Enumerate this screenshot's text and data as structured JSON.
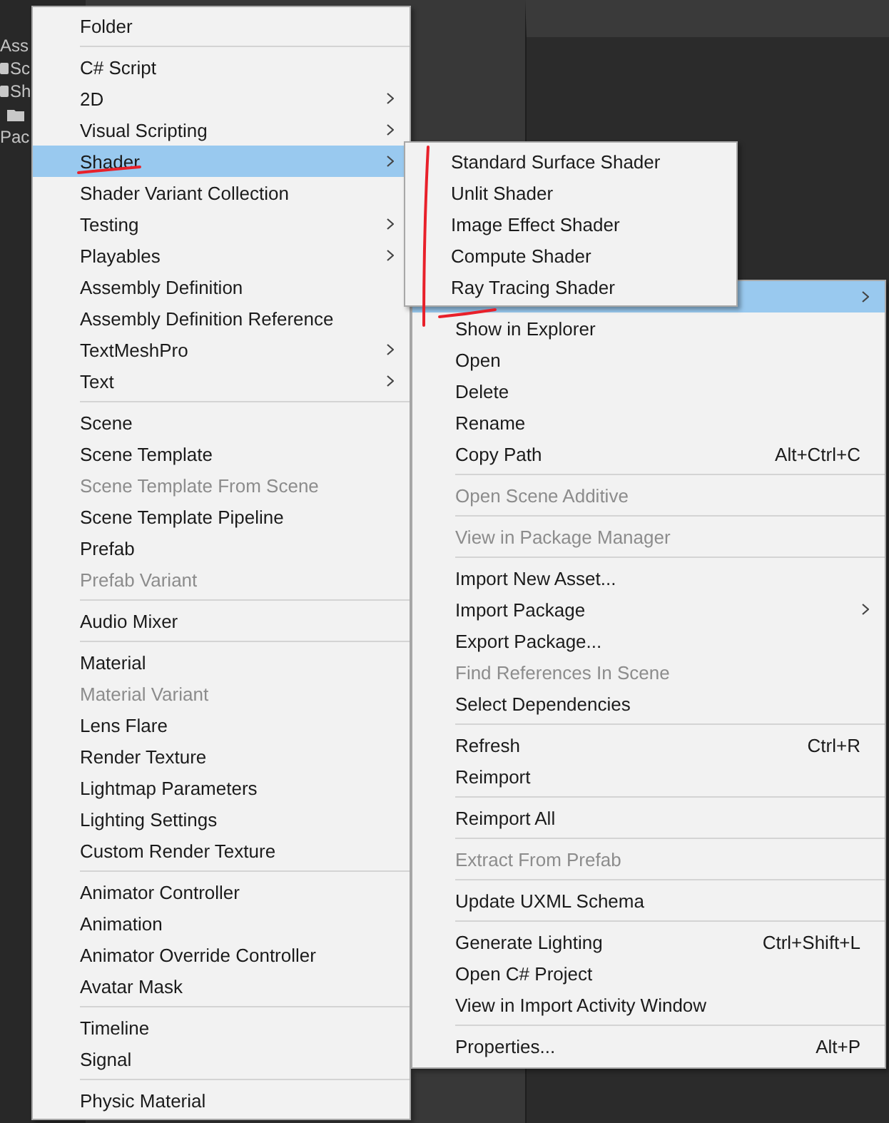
{
  "project_panel": {
    "items": [
      {
        "label": "Ass",
        "kind": "header"
      },
      {
        "label": "Sc",
        "kind": "script"
      },
      {
        "label": "Sh",
        "kind": "shader"
      },
      {
        "kind": "folder"
      },
      {
        "label": "Pac",
        "kind": "header"
      }
    ]
  },
  "create_menu": {
    "sections": [
      [
        {
          "label": "Folder",
          "has_submenu": false,
          "disabled": false,
          "selected": false
        }
      ],
      [
        {
          "label": "C# Script",
          "has_submenu": false,
          "disabled": false,
          "selected": false
        },
        {
          "label": "2D",
          "has_submenu": true,
          "disabled": false,
          "selected": false
        },
        {
          "label": "Visual Scripting",
          "has_submenu": true,
          "disabled": false,
          "selected": false
        },
        {
          "label": "Shader",
          "has_submenu": true,
          "disabled": false,
          "selected": true
        },
        {
          "label": "Shader Variant Collection",
          "has_submenu": false,
          "disabled": false,
          "selected": false
        },
        {
          "label": "Testing",
          "has_submenu": true,
          "disabled": false,
          "selected": false
        },
        {
          "label": "Playables",
          "has_submenu": true,
          "disabled": false,
          "selected": false
        },
        {
          "label": "Assembly Definition",
          "has_submenu": false,
          "disabled": false,
          "selected": false
        },
        {
          "label": "Assembly Definition Reference",
          "has_submenu": false,
          "disabled": false,
          "selected": false
        },
        {
          "label": "TextMeshPro",
          "has_submenu": true,
          "disabled": false,
          "selected": false
        },
        {
          "label": "Text",
          "has_submenu": true,
          "disabled": false,
          "selected": false
        }
      ],
      [
        {
          "label": "Scene",
          "has_submenu": false,
          "disabled": false,
          "selected": false
        },
        {
          "label": "Scene Template",
          "has_submenu": false,
          "disabled": false,
          "selected": false
        },
        {
          "label": "Scene Template From Scene",
          "has_submenu": false,
          "disabled": true,
          "selected": false
        },
        {
          "label": "Scene Template Pipeline",
          "has_submenu": false,
          "disabled": false,
          "selected": false
        },
        {
          "label": "Prefab",
          "has_submenu": false,
          "disabled": false,
          "selected": false
        },
        {
          "label": "Prefab Variant",
          "has_submenu": false,
          "disabled": true,
          "selected": false
        }
      ],
      [
        {
          "label": "Audio Mixer",
          "has_submenu": false,
          "disabled": false,
          "selected": false
        }
      ],
      [
        {
          "label": "Material",
          "has_submenu": false,
          "disabled": false,
          "selected": false
        },
        {
          "label": "Material Variant",
          "has_submenu": false,
          "disabled": true,
          "selected": false
        },
        {
          "label": "Lens Flare",
          "has_submenu": false,
          "disabled": false,
          "selected": false
        },
        {
          "label": "Render Texture",
          "has_submenu": false,
          "disabled": false,
          "selected": false
        },
        {
          "label": "Lightmap Parameters",
          "has_submenu": false,
          "disabled": false,
          "selected": false
        },
        {
          "label": "Lighting Settings",
          "has_submenu": false,
          "disabled": false,
          "selected": false
        },
        {
          "label": "Custom Render Texture",
          "has_submenu": false,
          "disabled": false,
          "selected": false
        }
      ],
      [
        {
          "label": "Animator Controller",
          "has_submenu": false,
          "disabled": false,
          "selected": false
        },
        {
          "label": "Animation",
          "has_submenu": false,
          "disabled": false,
          "selected": false
        },
        {
          "label": "Animator Override Controller",
          "has_submenu": false,
          "disabled": false,
          "selected": false
        },
        {
          "label": "Avatar Mask",
          "has_submenu": false,
          "disabled": false,
          "selected": false
        }
      ],
      [
        {
          "label": "Timeline",
          "has_submenu": false,
          "disabled": false,
          "selected": false
        },
        {
          "label": "Signal",
          "has_submenu": false,
          "disabled": false,
          "selected": false
        }
      ],
      [
        {
          "label": "Physic Material",
          "has_submenu": false,
          "disabled": false,
          "selected": false
        }
      ]
    ]
  },
  "shader_submenu": {
    "items": [
      {
        "label": "Standard Surface Shader"
      },
      {
        "label": "Unlit Shader"
      },
      {
        "label": "Image Effect Shader"
      },
      {
        "label": "Compute Shader"
      },
      {
        "label": "Ray Tracing Shader"
      }
    ]
  },
  "context_menu": {
    "sections": [
      [
        {
          "has_submenu": true,
          "disabled": false,
          "selected": true
        },
        {
          "label": "Show in Explorer",
          "has_submenu": false,
          "disabled": false,
          "selected": false
        },
        {
          "label": "Open",
          "has_submenu": false,
          "disabled": false,
          "selected": false
        },
        {
          "label": "Delete",
          "has_submenu": false,
          "disabled": false,
          "selected": false
        },
        {
          "label": "Rename",
          "has_submenu": false,
          "disabled": false,
          "selected": false
        },
        {
          "label": "Copy Path",
          "shortcut": "Alt+Ctrl+C",
          "has_submenu": false,
          "disabled": false,
          "selected": false
        }
      ],
      [
        {
          "label": "Open Scene Additive",
          "has_submenu": false,
          "disabled": true,
          "selected": false
        }
      ],
      [
        {
          "label": "View in Package Manager",
          "has_submenu": false,
          "disabled": true,
          "selected": false
        }
      ],
      [
        {
          "label": "Import New Asset...",
          "has_submenu": false,
          "disabled": false,
          "selected": false
        },
        {
          "label": "Import Package",
          "has_submenu": true,
          "disabled": false,
          "selected": false
        },
        {
          "label": "Export Package...",
          "has_submenu": false,
          "disabled": false,
          "selected": false
        },
        {
          "label": "Find References In Scene",
          "has_submenu": false,
          "disabled": true,
          "selected": false
        },
        {
          "label": "Select Dependencies",
          "has_submenu": false,
          "disabled": false,
          "selected": false
        }
      ],
      [
        {
          "label": "Refresh",
          "shortcut": "Ctrl+R",
          "has_submenu": false,
          "disabled": false,
          "selected": false
        },
        {
          "label": "Reimport",
          "has_submenu": false,
          "disabled": false,
          "selected": false
        }
      ],
      [
        {
          "label": "Reimport All",
          "has_submenu": false,
          "disabled": false,
          "selected": false
        }
      ],
      [
        {
          "label": "Extract From Prefab",
          "has_submenu": false,
          "disabled": true,
          "selected": false
        }
      ],
      [
        {
          "label": "Update UXML Schema",
          "has_submenu": false,
          "disabled": false,
          "selected": false
        }
      ],
      [
        {
          "label": "Generate Lighting",
          "shortcut": "Ctrl+Shift+L",
          "has_submenu": false,
          "disabled": false,
          "selected": false
        },
        {
          "label": "Open C# Project",
          "has_submenu": false,
          "disabled": false,
          "selected": false
        },
        {
          "label": "View in Import Activity Window",
          "has_submenu": false,
          "disabled": false,
          "selected": false
        }
      ],
      [
        {
          "label": "Properties...",
          "shortcut": "Alt+P",
          "has_submenu": false,
          "disabled": false,
          "selected": false
        }
      ]
    ]
  }
}
